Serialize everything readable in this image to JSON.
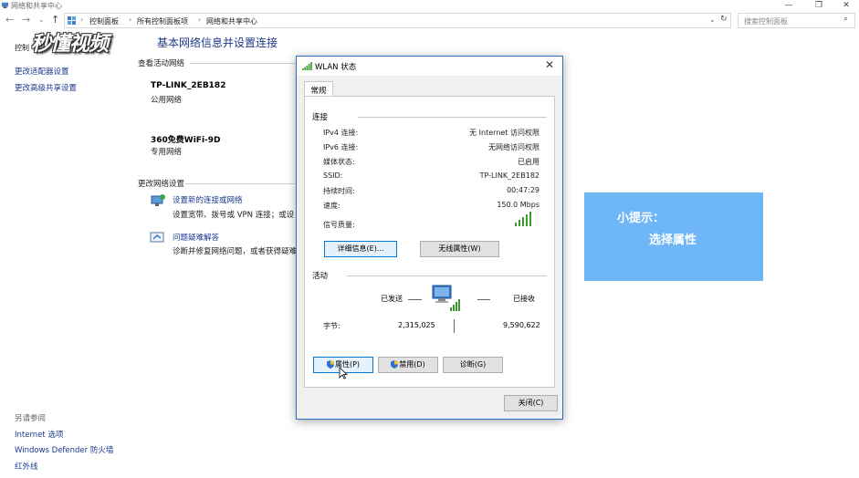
{
  "window": {
    "title": "网络和共享中心"
  },
  "address": {
    "crumbs": [
      "控制面板",
      "所有控制面板项",
      "网络和共享中心"
    ],
    "search_placeholder": "搜索控制面板"
  },
  "left_pane": {
    "home": "控制",
    "links": [
      "更改适配器设置",
      "更改高级共享设置"
    ],
    "see_also_header": "另请参阅",
    "see_also": [
      "Internet 选项",
      "Windows Defender 防火墙",
      "红外线"
    ]
  },
  "main": {
    "title": "基本网络信息并设置连接",
    "active_networks_header": "查看活动网络",
    "networks": [
      {
        "name": "TP-LINK_2EB182",
        "type": "公用网络"
      },
      {
        "name": "360免费WiFi-9D",
        "type": "专用网络"
      }
    ],
    "change_header": "更改网络设置",
    "tasks": [
      {
        "link": "设置新的连接或网络",
        "desc": "设置宽带、拨号或 VPN 连接；或设"
      },
      {
        "link": "问题疑难解答",
        "desc": "诊断并修复网络问题，或者获得疑难"
      }
    ]
  },
  "watermark": "秒懂视频",
  "tip": {
    "heading": "小提示：",
    "body": "选择属性"
  },
  "dialog": {
    "title": "WLAN 状态",
    "tab": "常规",
    "connection_header": "连接",
    "rows": [
      {
        "label": "IPv4 连接:",
        "value": "无 Internet 访问权限"
      },
      {
        "label": "IPv6 连接:",
        "value": "无网络访问权限"
      },
      {
        "label": "媒体状态:",
        "value": "已启用"
      },
      {
        "label": "SSID:",
        "value": "TP-LINK_2EB182"
      },
      {
        "label": "持续时间:",
        "value": "00:47:29"
      },
      {
        "label": "速度:",
        "value": "150.0 Mbps"
      }
    ],
    "signal_label": "信号质量:",
    "signal_bars": 5,
    "details_button": "详细信息(E)...",
    "wireless_button": "无线属性(W)",
    "activity_header": "活动",
    "sent_label": "已发送",
    "received_label": "已接收",
    "bytes_label": "字节:",
    "bytes_sent": "2,315,025",
    "bytes_received": "9,590,622",
    "properties_button": "属性(P)",
    "disable_button": "禁用(D)",
    "diagnose_button": "诊断(G)",
    "close_button": "关闭(C)",
    "colors": {
      "accent": "#0078d7",
      "signal": "#3c9a2e"
    }
  }
}
